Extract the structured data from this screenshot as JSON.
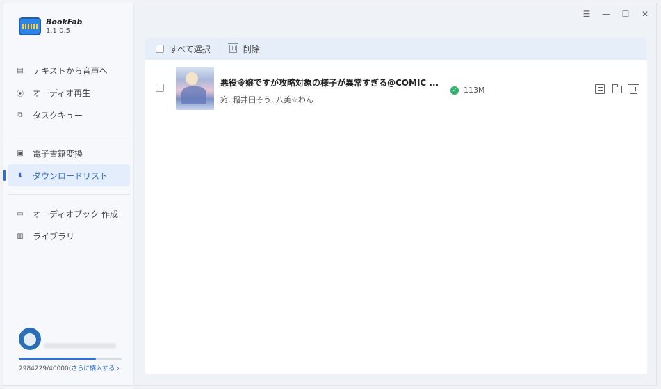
{
  "app": {
    "name": "BookFab",
    "version": "1.1.0.5"
  },
  "sidebar": {
    "groups": [
      [
        {
          "id": "text-to-speech",
          "label": "テキストから音声へ",
          "icon": "document-icon"
        },
        {
          "id": "audio-play",
          "label": "オーディオ再生",
          "icon": "play-circle-icon"
        },
        {
          "id": "task-queue",
          "label": "タスクキュー",
          "icon": "queue-icon"
        }
      ],
      [
        {
          "id": "ebook-convert",
          "label": "電子書籍変換",
          "icon": "ebook-icon"
        },
        {
          "id": "download-list",
          "label": "ダウンロードリスト",
          "icon": "download-icon",
          "active": true
        }
      ],
      [
        {
          "id": "audiobook-create",
          "label": "オーディオブック 作成",
          "icon": "audiobook-icon"
        },
        {
          "id": "library",
          "label": "ライブラリ",
          "icon": "library-icon"
        }
      ]
    ]
  },
  "user": {
    "quota_text": "2984229/40000(",
    "quota_fraction": 0.75,
    "upgrade_label": "さらに購入する ›"
  },
  "titlebar": {
    "icons": [
      "menu-icon",
      "minimize-icon",
      "maximize-icon",
      "close-icon"
    ]
  },
  "toolbar": {
    "select_all": "すべて選択",
    "delete": "削除"
  },
  "downloads": [
    {
      "title": "悪役令嬢ですが攻略対象の様子が異常すぎる@COMIC ...",
      "author": "宛, 稲井田そう, 八美☆わん",
      "size": "113M",
      "status": "completed"
    }
  ],
  "colors": {
    "accent": "#2d6fd6",
    "success": "#2fb26b",
    "toolbar_bg": "#e6eefa"
  }
}
